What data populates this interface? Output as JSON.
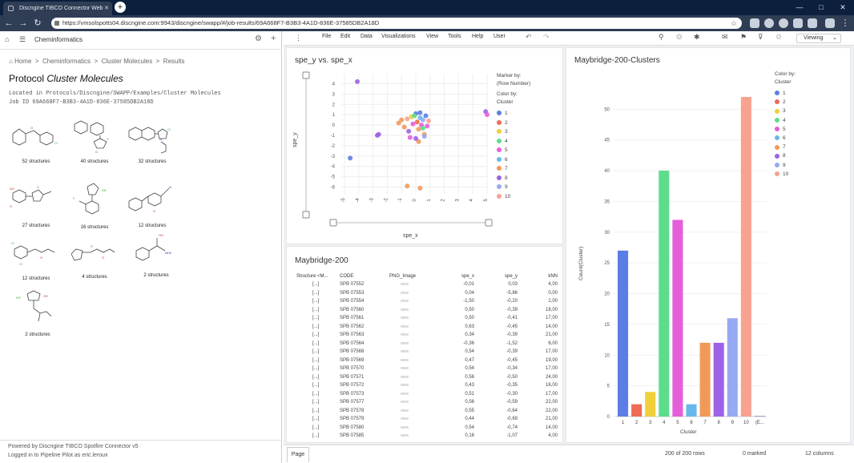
{
  "browser": {
    "tab_title": "Discngine TIBCO Connector Web",
    "url": "https://vmsolspotts04.discngine.com:9943/discngine/swapp/#/job-results/69A668F7-B3B3-4A1D-836E-37585DB2A18D"
  },
  "left": {
    "header": "Cheminformatics",
    "breadcrumb": [
      "Home",
      "Cheminformatics",
      "Cluster Molecules",
      "Results"
    ],
    "title_prefix": "Protocol",
    "title_name": "Cluster Molecules",
    "location": "Located in Protocols/Discngine/SWAPP/Examples/Cluster Molecules",
    "job_id": "Job ID 69A668F7-B3B3-4A1D-836E-37585DB2A18D",
    "clusters": [
      {
        "caption": "52 structures"
      },
      {
        "caption": "40 structures"
      },
      {
        "caption": "32 structures"
      },
      {
        "caption": "27 structures"
      },
      {
        "caption": "16 structures"
      },
      {
        "caption": "12 structures"
      },
      {
        "caption": "12 structures"
      },
      {
        "caption": "4 structures"
      },
      {
        "caption": "2 structures"
      },
      {
        "caption": "2 structures"
      }
    ],
    "footer_line1": "Powered by Discngine TIBCO Spotfire Connector v5",
    "footer_line2_prefix": "Logged in to Pipeline Pilot as",
    "footer_user": "eric.leroux"
  },
  "toolbar": {
    "menus": [
      "File",
      "Edit",
      "Data",
      "Visualizations",
      "View",
      "Tools",
      "Help",
      "User"
    ],
    "mode": "Viewing"
  },
  "colors": {
    "1": "#5b7ee6",
    "2": "#ee6b55",
    "3": "#f1cf3a",
    "4": "#5ddd8b",
    "5": "#e55fdb",
    "6": "#67b9ea",
    "7": "#f2995a",
    "8": "#9d62e8",
    "9": "#97a9f2",
    "10": "#f8a291"
  },
  "scatter": {
    "title": "spe_y vs. spe_x",
    "xlabel": "spe_x",
    "ylabel": "spe_y",
    "marker_by_label": "Marker by:",
    "marker_by_value": "(Row Number)",
    "color_by_label": "Color by:",
    "color_by_value": "Cluster",
    "legend": [
      "1",
      "2",
      "3",
      "4",
      "5",
      "6",
      "7",
      "8",
      "9",
      "10"
    ]
  },
  "chart_data": [
    {
      "type": "scatter",
      "title": "spe_y vs. spe_x",
      "xlabel": "spe_x",
      "ylabel": "spe_y",
      "xlim": [
        -5,
        5
      ],
      "ylim": [
        -6.5,
        4.5
      ],
      "xticks": [
        "-5",
        "-4",
        "-3",
        "-2",
        "-1",
        "0",
        "1",
        "2",
        "3",
        "4",
        "5"
      ],
      "yticks": [
        "4",
        "3",
        "2",
        "1",
        "0",
        "-1",
        "-2",
        "-3",
        "-4",
        "-5",
        "-6"
      ],
      "points": [
        {
          "x": -4.6,
          "y": -3.2,
          "c": "1"
        },
        {
          "x": -4.1,
          "y": 4.2,
          "c": "8"
        },
        {
          "x": -2.7,
          "y": -1.0,
          "c": "8"
        },
        {
          "x": -2.6,
          "y": -0.9,
          "c": "8"
        },
        {
          "x": -1.2,
          "y": 0.2,
          "c": "7"
        },
        {
          "x": -1.0,
          "y": 0.5,
          "c": "7"
        },
        {
          "x": -0.8,
          "y": -0.2,
          "c": "7"
        },
        {
          "x": -0.6,
          "y": 0.6,
          "c": "10"
        },
        {
          "x": -0.5,
          "y": -0.6,
          "c": "8"
        },
        {
          "x": -0.3,
          "y": 0.8,
          "c": "3"
        },
        {
          "x": -0.2,
          "y": 0.1,
          "c": "5"
        },
        {
          "x": 0.0,
          "y": 1.1,
          "c": "1"
        },
        {
          "x": 0.1,
          "y": 0.3,
          "c": "2"
        },
        {
          "x": 0.2,
          "y": -0.4,
          "c": "7"
        },
        {
          "x": 0.3,
          "y": 0.7,
          "c": "6"
        },
        {
          "x": 0.4,
          "y": 0.0,
          "c": "5"
        },
        {
          "x": 0.5,
          "y": -0.3,
          "c": "4"
        },
        {
          "x": 0.5,
          "y": 0.5,
          "c": "9"
        },
        {
          "x": 0.6,
          "y": -0.9,
          "c": "7"
        },
        {
          "x": 0.7,
          "y": 0.9,
          "c": "1"
        },
        {
          "x": 0.8,
          "y": -0.1,
          "c": "5"
        },
        {
          "x": 0.9,
          "y": 0.4,
          "c": "10"
        },
        {
          "x": 0.2,
          "y": -1.6,
          "c": "7"
        },
        {
          "x": 0.0,
          "y": -1.3,
          "c": "8"
        },
        {
          "x": -0.4,
          "y": -1.2,
          "c": "5"
        },
        {
          "x": 0.6,
          "y": -1.1,
          "c": "9"
        },
        {
          "x": -0.6,
          "y": -5.9,
          "c": "7"
        },
        {
          "x": 0.3,
          "y": -6.1,
          "c": "7"
        },
        {
          "x": 4.9,
          "y": 1.3,
          "c": "8"
        },
        {
          "x": 5.0,
          "y": 1.0,
          "c": "5"
        },
        {
          "x": -0.1,
          "y": 0.9,
          "c": "4"
        },
        {
          "x": 0.3,
          "y": 1.2,
          "c": "1"
        }
      ]
    },
    {
      "type": "bar",
      "title": "Maybridge-200-Clusters",
      "xlabel": "Cluster",
      "ylabel": "Count(Cluster)",
      "categories": [
        "1",
        "2",
        "3",
        "4",
        "5",
        "6",
        "7",
        "8",
        "9",
        "10",
        "(E..."
      ],
      "values": [
        27,
        2,
        4,
        40,
        32,
        2,
        12,
        12,
        16,
        52,
        0
      ],
      "ylim": [
        0,
        55
      ],
      "yticks": [
        0,
        5,
        10,
        15,
        20,
        25,
        30,
        35,
        40,
        45,
        50
      ]
    }
  ],
  "bar_panel": {
    "title": "Maybridge-200-Clusters",
    "color_by_label": "Color by:",
    "color_by_value": "Cluster",
    "legend": [
      "1",
      "2",
      "3",
      "4",
      "5",
      "6",
      "7",
      "8",
      "9",
      "10"
    ]
  },
  "table": {
    "title": "Maybridge-200",
    "columns": [
      "Structure <M...",
      "CODE",
      "PNG_Image",
      "spe_x",
      "spe_y",
      "kNN"
    ],
    "rows": [
      [
        "[...]",
        "SPB 07552",
        "-0,01",
        "0,03",
        "4,00"
      ],
      [
        "[...]",
        "SPB 07553",
        "0,04",
        "-5,86",
        "0,00"
      ],
      [
        "[...]",
        "SPB 07554",
        "-1,50",
        "-0,20",
        "2,00"
      ],
      [
        "[...]",
        "SPB 07560",
        "0,50",
        "-0,39",
        "18,00"
      ],
      [
        "[...]",
        "SPB 07561",
        "0,50",
        "-0,41",
        "17,00"
      ],
      [
        "[...]",
        "SPB 07562",
        "0,63",
        "-0,45",
        "14,00"
      ],
      [
        "[...]",
        "SPB 07563",
        "0,34",
        "-0,39",
        "21,00"
      ],
      [
        "[...]",
        "SPB 07564",
        "-0,36",
        "-1,52",
        "6,00"
      ],
      [
        "[...]",
        "SPB 07568",
        "0,54",
        "-0,39",
        "17,00"
      ],
      [
        "[...]",
        "SPB 07569",
        "0,47",
        "-0,45",
        "19,00"
      ],
      [
        "[...]",
        "SPB 07570",
        "0,54",
        "-0,34",
        "17,00"
      ],
      [
        "[...]",
        "SPB 07571",
        "0,56",
        "-0,50",
        "24,00"
      ],
      [
        "[...]",
        "SPB 07572",
        "0,43",
        "-0,35",
        "16,00"
      ],
      [
        "[...]",
        "SPB 07573",
        "0,51",
        "-0,30",
        "17,00"
      ],
      [
        "[...]",
        "SPB 07577",
        "0,56",
        "-0,59",
        "22,00"
      ],
      [
        "[...]",
        "SPB 07578",
        "0,55",
        "-0,64",
        "22,00"
      ],
      [
        "[...]",
        "SPB 07579",
        "0,44",
        "-0,69",
        "21,00"
      ],
      [
        "[...]",
        "SPB 07580",
        "0,54",
        "-0,74",
        "14,00"
      ],
      [
        "[...]",
        "SPB 07585",
        "0,16",
        "-1,07",
        "4,00"
      ]
    ]
  },
  "status": {
    "page_tab": "Page",
    "rows": "200 of 200 rows",
    "marked": "0 marked",
    "columns": "12 columns"
  }
}
